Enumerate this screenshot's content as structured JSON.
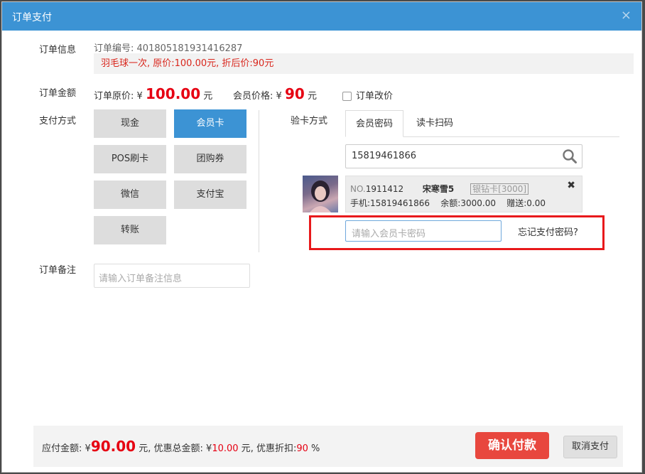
{
  "dialog": {
    "title": "订单支付",
    "close_icon": "×"
  },
  "order_info": {
    "label": "订单信息",
    "order_no_label": "订单编号:",
    "order_no": "401805181931416287",
    "promo_text": "羽毛球一次, 原价:100.00元, 折后价:90元"
  },
  "order_amount": {
    "label": "订单金额",
    "original_label": "订单原价:",
    "currency": "¥",
    "original_value": "100.00",
    "unit": "元",
    "member_label": "会员价格:",
    "member_value": "90",
    "edit_price_label": "订单改价"
  },
  "payment": {
    "label": "支付方式",
    "methods": [
      {
        "label": "现金",
        "active": false
      },
      {
        "label": "会员卡",
        "active": true
      },
      {
        "label": "POS刷卡",
        "active": false
      },
      {
        "label": "团购券",
        "active": false
      },
      {
        "label": "微信",
        "active": false
      },
      {
        "label": "支付宝",
        "active": false
      },
      {
        "label": "转账",
        "active": false
      }
    ]
  },
  "card_verify": {
    "label": "验卡方式",
    "tabs": [
      {
        "label": "会员密码",
        "active": true
      },
      {
        "label": "读卡扫码",
        "active": false
      }
    ],
    "search_value": "15819461866",
    "search_icon": "search-icon"
  },
  "member": {
    "no_label": "NO.",
    "no": "1911412",
    "name": "宋寒雪5",
    "card_type": "银钻卡[3000]",
    "phone_label": "手机:",
    "phone": "15819461866",
    "balance_label": "余额:",
    "balance": "3000.00",
    "gift_label": "赠送:",
    "gift": "0.00",
    "remove_icon": "✖"
  },
  "password": {
    "placeholder": "请输入会员卡密码",
    "forgot_label": "忘记支付密码?"
  },
  "remark": {
    "label": "订单备注",
    "placeholder": "请输入订单备注信息"
  },
  "footer": {
    "payable_label": "应付金额:",
    "currency": "¥",
    "payable_value": "90.00",
    "unit": "元",
    "discount_total_label": "优惠总金额:",
    "discount_total_value": "10.00",
    "discount_rate_label": "优惠折扣:",
    "discount_rate_value": "90",
    "percent": "%",
    "confirm_label": "确认付款",
    "cancel_label": "取消支付"
  },
  "colors": {
    "primary": "#3c93d4",
    "accent_red": "#e60012",
    "confirm_bg": "#e8473e",
    "highlight_frame": "#e8191b"
  }
}
